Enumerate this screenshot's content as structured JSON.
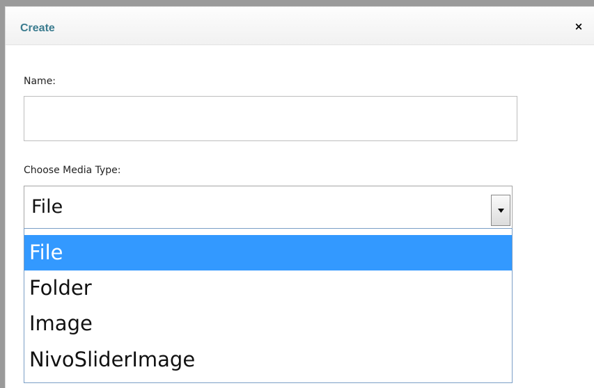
{
  "dialog": {
    "title": "Create",
    "close_symbol": "×",
    "close_icon": "close-icon"
  },
  "form": {
    "name_label": "Name:",
    "name_value": "",
    "media_type_label": "Choose Media Type:",
    "media_type_selected": "File",
    "dropdown_icon": "chevron-down-icon",
    "options": [
      {
        "label": "File",
        "highlighted": true
      },
      {
        "label": "Folder",
        "highlighted": false
      },
      {
        "label": "Image",
        "highlighted": false
      },
      {
        "label": "NivoSliderImage",
        "highlighted": false
      }
    ]
  },
  "colors": {
    "title": "#3b7c8f",
    "highlight": "#3399ff",
    "backdrop": "#9a9a9a"
  }
}
